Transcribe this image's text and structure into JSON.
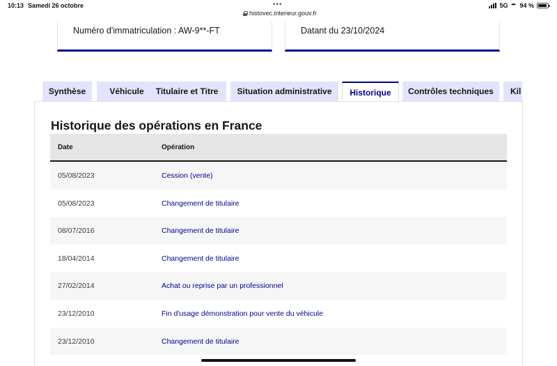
{
  "status_bar": {
    "time": "10:13",
    "date": "Samedi 26 octobre",
    "url": "histovec.interieur.gouv.fr",
    "network": "5G",
    "battery": "94 %",
    "battery_level": 0.94
  },
  "cards": {
    "registration": "Numéro d'immatriculation : AW-9**-FT",
    "dated": "Datant du 23/10/2024"
  },
  "tabs": [
    {
      "label": "Synthèse",
      "active": false
    },
    {
      "label": "Véhicule",
      "active": false
    },
    {
      "label": "Titulaire et Titre",
      "active": false
    },
    {
      "label": "Situation administrative",
      "active": false
    },
    {
      "label": "Historique",
      "active": true
    },
    {
      "label": "Contrôles techniques",
      "active": false
    },
    {
      "label": "Kil",
      "active": false
    }
  ],
  "section": {
    "title": "Historique des opérations en France",
    "columns": {
      "date": "Date",
      "operation": "Opération"
    },
    "rows": [
      {
        "date": "05/08/2023",
        "operation": "Cession (vente)"
      },
      {
        "date": "05/08/2023",
        "operation": "Changement de titulaire"
      },
      {
        "date": "08/07/2016",
        "operation": "Changement de titulaire"
      },
      {
        "date": "18/04/2014",
        "operation": "Changement de titulaire"
      },
      {
        "date": "27/02/2014",
        "operation": "Achat ou reprise par un professionnel"
      },
      {
        "date": "23/12/2010",
        "operation": "Fin d'usage démonstration pour vente du véhicule"
      },
      {
        "date": "23/12/2010",
        "operation": "Changement de titulaire"
      }
    ]
  },
  "colors": {
    "accent": "#000091",
    "tab_background": "#e3e3fd",
    "row_alt": "#f6f6f6",
    "header_bg": "#e5e5e5"
  }
}
